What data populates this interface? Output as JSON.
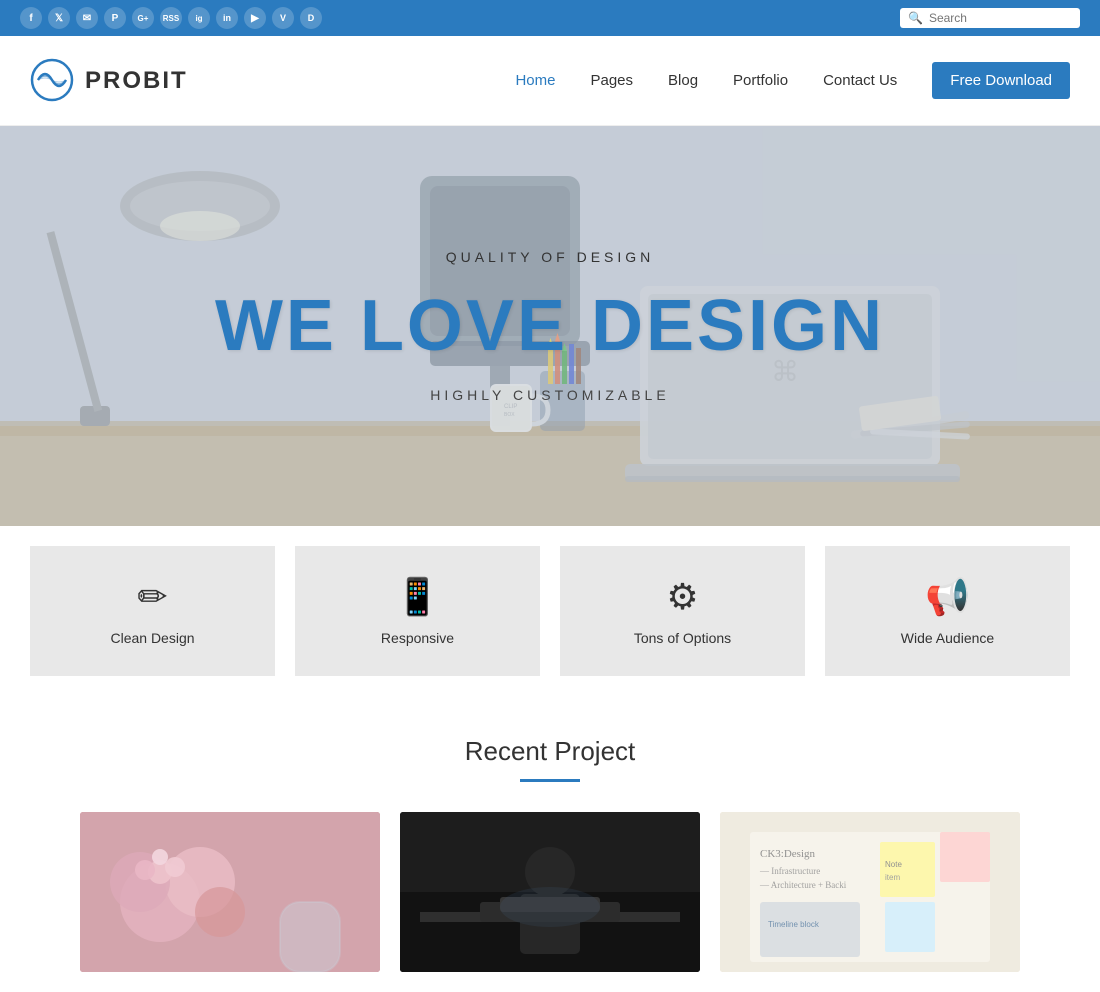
{
  "topbar": {
    "social_icons": [
      {
        "name": "facebook",
        "symbol": "f"
      },
      {
        "name": "twitter",
        "symbol": "t"
      },
      {
        "name": "email",
        "symbol": "✉"
      },
      {
        "name": "pinterest",
        "symbol": "p"
      },
      {
        "name": "google-plus",
        "symbol": "g+"
      },
      {
        "name": "rss",
        "symbol": "◎"
      },
      {
        "name": "instagram",
        "symbol": "ig"
      },
      {
        "name": "linkedin",
        "symbol": "in"
      },
      {
        "name": "youtube",
        "symbol": "▶"
      },
      {
        "name": "vimeo",
        "symbol": "v"
      },
      {
        "name": "dribbble",
        "symbol": "d"
      }
    ],
    "search_placeholder": "Search"
  },
  "header": {
    "logo_text": "PROBIT",
    "nav_items": [
      {
        "label": "Home",
        "active": true
      },
      {
        "label": "Pages",
        "active": false
      },
      {
        "label": "Blog",
        "active": false
      },
      {
        "label": "Portfolio",
        "active": false
      },
      {
        "label": "Contact Us",
        "active": false
      },
      {
        "label": "Free Download",
        "active": false,
        "special": true
      }
    ]
  },
  "hero": {
    "subtitle": "QUALITY OF DESIGN",
    "title": "WE LOVE DESIGN",
    "tagline": "HIGHLY CUSTOMIZABLE"
  },
  "features": [
    {
      "icon": "✏",
      "label": "Clean Design"
    },
    {
      "icon": "📱",
      "label": "Responsive"
    },
    {
      "icon": "⚙",
      "label": "Tons of Options"
    },
    {
      "icon": "📢",
      "label": "Wide Audience"
    }
  ],
  "recent_project": {
    "title": "Recent Project",
    "projects": [
      {
        "alt": "Flowers project"
      },
      {
        "alt": "Business project"
      },
      {
        "alt": "Design notes project"
      }
    ]
  }
}
